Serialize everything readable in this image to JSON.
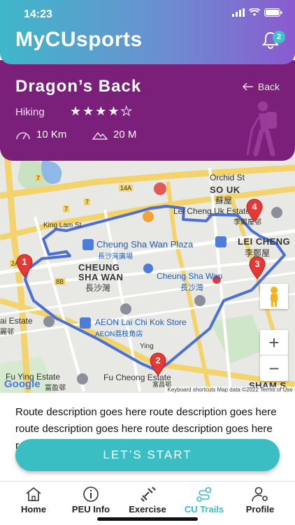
{
  "status": {
    "time": "14:23"
  },
  "header": {
    "app_title": "MyCUsports",
    "notification_count": "2"
  },
  "trail": {
    "name": "Dragon’s Back",
    "back_label": "Back",
    "type": "Hiking",
    "rating": 4,
    "rating_max": 5,
    "distance": "10 Km",
    "elevation": "20 M"
  },
  "map": {
    "labels": {
      "orchid": "Orchid St",
      "so_uk": "SO UK",
      "so_uk_zh": "蘇屋",
      "lei_cheng_uk_estate": "Lei Cheng Uk Estate",
      "lei_cheng_uk_estate_zh": "李鄭屋邨",
      "lei_cheng": "LEI CHENG",
      "lei_cheng_zh": "李鄭屋",
      "king_lam": "King Lam St",
      "cheung_sha_wan_plaza": "Cheung Sha Wan Plaza",
      "cheung_sha_wan_plaza_zh": "長沙灣廣場",
      "cheung_sha_wan": "CHEUNG",
      "sha_wan": "SHA WAN",
      "sha_wan_zh": "長沙灣",
      "cheung_sha_wan_station": "Cheung Sha Wan",
      "cheung_sha_wan_station_zh": "長沙灣",
      "aeon": "AEON Lai Chi Kok Store",
      "aeon_zh": "AEON荔枝角店",
      "lai_estate": "ai Estate",
      "lai_estate_zh": "麗邨",
      "fu_cheong": "Fu Cheong Estate",
      "fu_cheong_zh": "富昌邨",
      "fu_ying": "Fu Ying Estate",
      "fu_ying_zh": "富盈邨",
      "sham_s": "SHAM S",
      "ying": "Ying",
      "route_14a": "14A",
      "route_7": "7",
      "route_8b": "8B",
      "route_7b": "7",
      "route_2a": "2A",
      "route_7c": "7",
      "zoom_in": "+",
      "zoom_out": "−",
      "google": "Google",
      "attribution": "Keyboard shortcuts   Map data ©2022   Terms of Use"
    },
    "markers": [
      "1",
      "2",
      "3",
      "4"
    ]
  },
  "description": "Route description goes here route description goes here route description goes here route description goes here route description goes here route description goes",
  "cta": {
    "start_label": "LET’S START"
  },
  "tabs": [
    {
      "label": "Home"
    },
    {
      "label": "PEU Info"
    },
    {
      "label": "Exercise"
    },
    {
      "label": "CU Trails"
    },
    {
      "label": "Profile"
    }
  ],
  "colors": {
    "teal": "#3bbdc4",
    "purple": "#7a1f7a",
    "route": "#4a6fd8",
    "pin": "#e53935"
  }
}
